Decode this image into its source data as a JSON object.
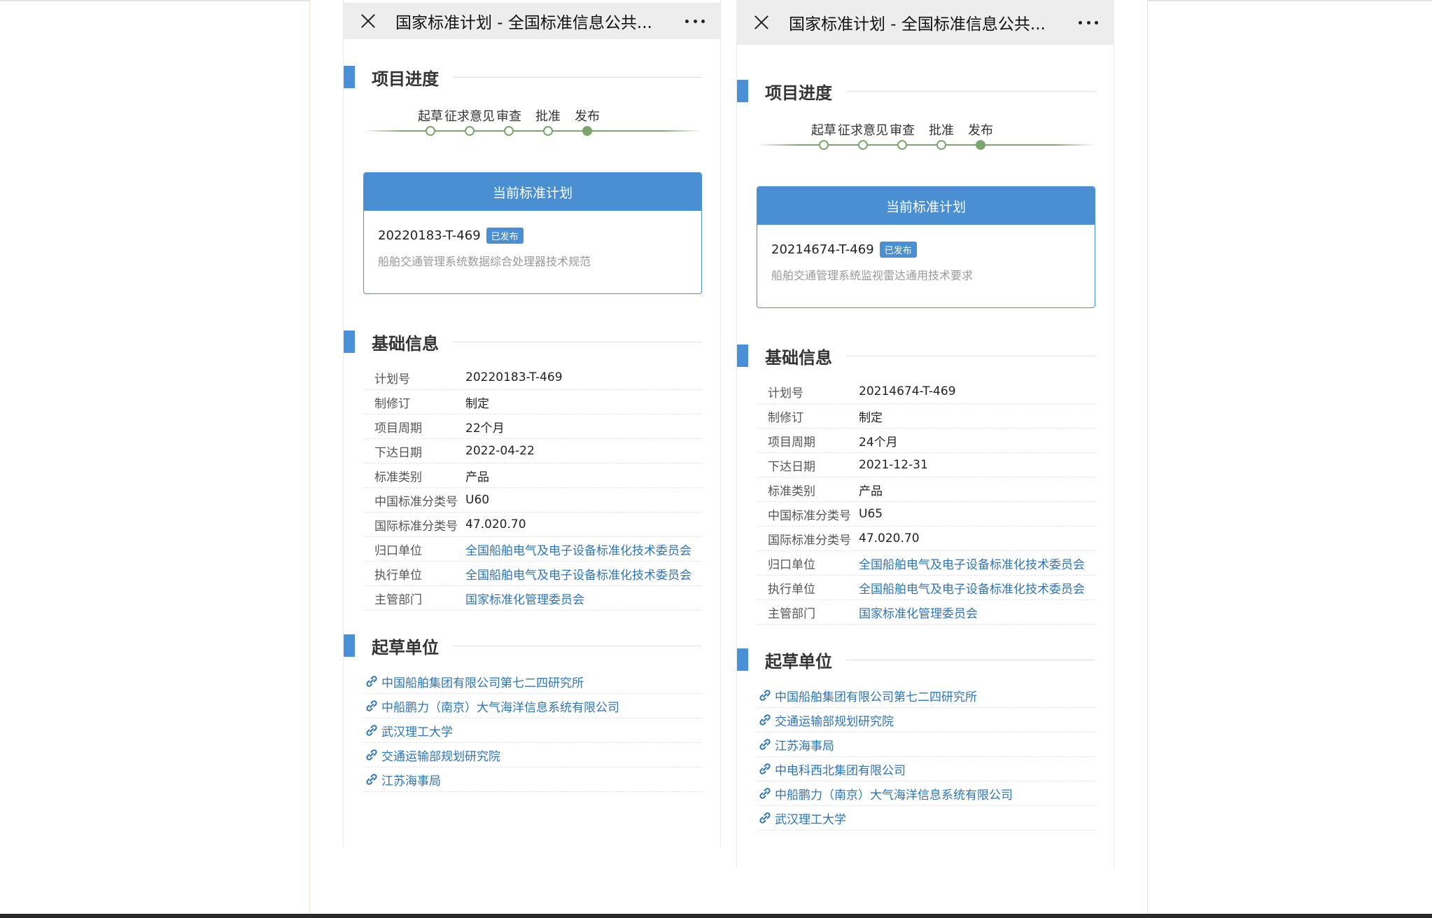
{
  "phones": [
    {
      "title": "国家标准计划 - 全国标准信息公共...",
      "sections": {
        "progress": "项目进度",
        "current_plan": "当前标准计划",
        "basic_info": "基础信息",
        "drafting": "起草单位"
      },
      "steps": [
        {
          "label": "起草",
          "done": false
        },
        {
          "label": "征求意见",
          "done": false
        },
        {
          "label": "审查",
          "done": false
        },
        {
          "label": "批准",
          "done": false
        },
        {
          "label": "发布",
          "done": true
        }
      ],
      "plan": {
        "number": "20220183-T-469",
        "status": "已发布",
        "name": "船舶交通管理系统数据综合处理器技术规范"
      },
      "info": [
        {
          "key": "计划号",
          "value": "20220183-T-469",
          "link": false
        },
        {
          "key": "制修订",
          "value": "制定",
          "link": false
        },
        {
          "key": "项目周期",
          "value": "22个月",
          "link": false
        },
        {
          "key": "下达日期",
          "value": "2022-04-22",
          "link": false
        },
        {
          "key": "标准类别",
          "value": "产品",
          "link": false
        },
        {
          "key": "中国标准分类号",
          "value": "U60",
          "link": false
        },
        {
          "key": "国际标准分类号",
          "value": "47.020.70",
          "link": false
        },
        {
          "key": "归口单位",
          "value": "全国船舶电气及电子设备标准化技术委员会",
          "link": true
        },
        {
          "key": "执行单位",
          "value": "全国船舶电气及电子设备标准化技术委员会",
          "link": true
        },
        {
          "key": "主管部门",
          "value": "国家标准化管理委员会",
          "link": true
        }
      ],
      "drafters": [
        "中国船舶集团有限公司第七二四研究所",
        "中船鹏力（南京）大气海洋信息系统有限公司",
        "武汉理工大学",
        "交通运输部规划研究院",
        "江苏海事局"
      ]
    },
    {
      "title": "国家标准计划 - 全国标准信息公共...",
      "sections": {
        "progress": "项目进度",
        "current_plan": "当前标准计划",
        "basic_info": "基础信息",
        "drafting": "起草单位"
      },
      "steps": [
        {
          "label": "起草",
          "done": false
        },
        {
          "label": "征求意见",
          "done": false
        },
        {
          "label": "审查",
          "done": false
        },
        {
          "label": "批准",
          "done": false
        },
        {
          "label": "发布",
          "done": true
        }
      ],
      "plan": {
        "number": "20214674-T-469",
        "status": "已发布",
        "name": "船舶交通管理系统监视雷达通用技术要求"
      },
      "info": [
        {
          "key": "计划号",
          "value": "20214674-T-469",
          "link": false
        },
        {
          "key": "制修订",
          "value": "制定",
          "link": false
        },
        {
          "key": "项目周期",
          "value": "24个月",
          "link": false
        },
        {
          "key": "下达日期",
          "value": "2021-12-31",
          "link": false
        },
        {
          "key": "标准类别",
          "value": "产品",
          "link": false
        },
        {
          "key": "中国标准分类号",
          "value": "U65",
          "link": false
        },
        {
          "key": "国际标准分类号",
          "value": "47.020.70",
          "link": false
        },
        {
          "key": "归口单位",
          "value": "全国船舶电气及电子设备标准化技术委员会",
          "link": true
        },
        {
          "key": "执行单位",
          "value": "全国船舶电气及电子设备标准化技术委员会",
          "link": true
        },
        {
          "key": "主管部门",
          "value": "国家标准化管理委员会",
          "link": true
        }
      ],
      "drafters": [
        "中国船舶集团有限公司第七二四研究所",
        "交通运输部规划研究院",
        "江苏海事局",
        "中电科西北集团有限公司",
        "中船鹏力（南京）大气海洋信息系统有限公司",
        "武汉理工大学"
      ]
    }
  ]
}
